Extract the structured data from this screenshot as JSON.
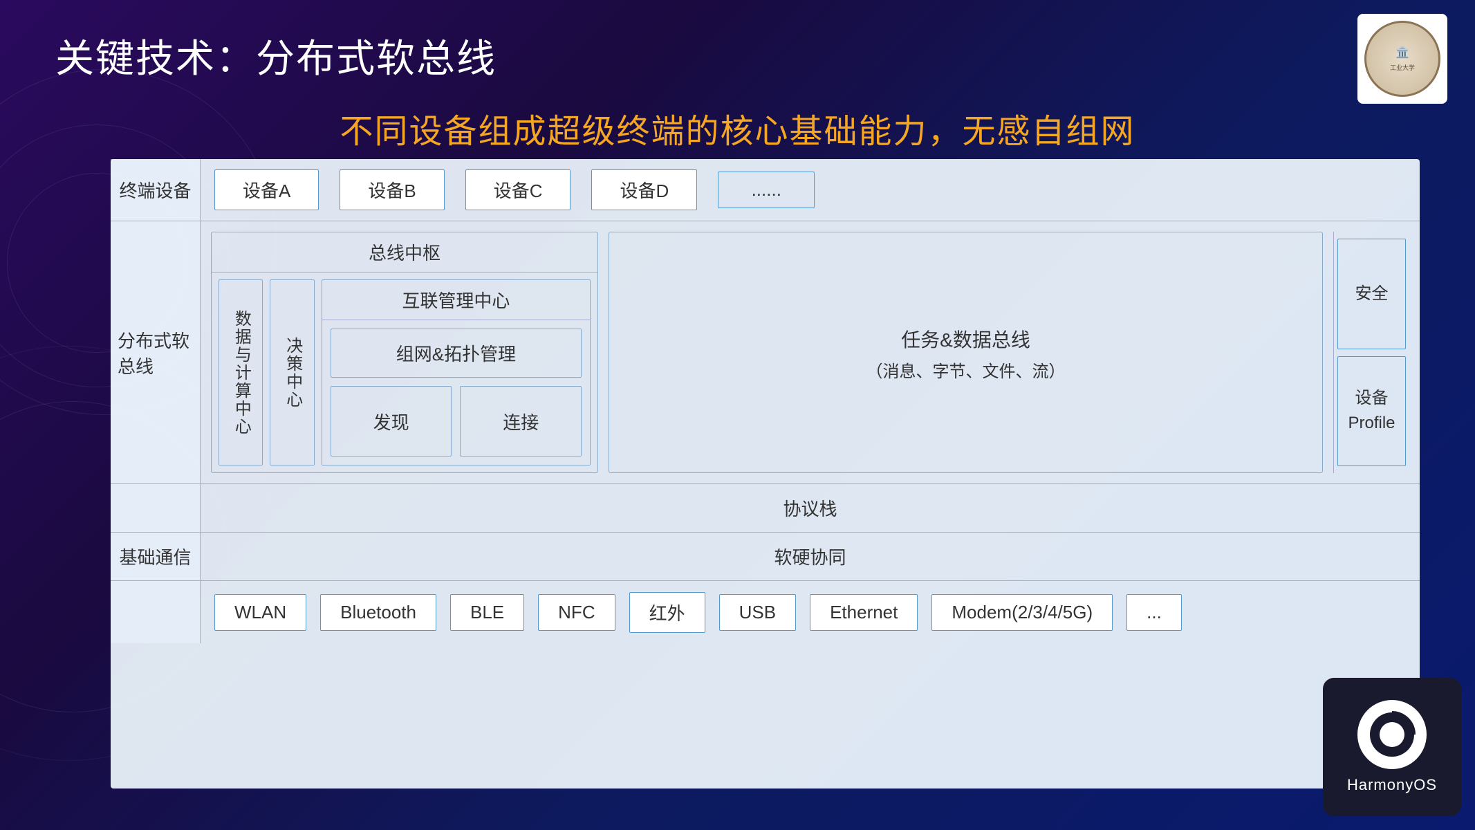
{
  "page": {
    "title": "关键技术：分布式软总线",
    "subtitle": "不同设备组成超级终端的核心基础能力，无感自组网"
  },
  "diagram": {
    "row_terminal": {
      "label": "终端设备",
      "devices": [
        "设备A",
        "设备B",
        "设备C",
        "设备D"
      ],
      "dots": "......"
    },
    "row_bus": {
      "label": "分布式软总线",
      "bus_hub": {
        "title": "总线中枢",
        "data_center": "数据与计算中心",
        "decision_center": "决策中心",
        "interconnect": {
          "title": "互联管理中心",
          "network_mgmt": "组网&拓扑管理",
          "discover": "发现",
          "connect": "连接"
        }
      },
      "task_bus": {
        "title": "任务&数据总线",
        "subtitle": "（消息、字节、文件、流）"
      },
      "right_items": {
        "safety": "安全",
        "device_profile": "设备\nProfile"
      }
    },
    "row_protocol": {
      "label": "",
      "content": "协议栈"
    },
    "row_basic": {
      "label": "基础通信",
      "soft_hard": "软硬协同",
      "technologies": [
        "WLAN",
        "Bluetooth",
        "BLE",
        "NFC",
        "红外",
        "USB",
        "Ethernet",
        "Modem(2/3/4/5G)",
        "..."
      ]
    }
  },
  "logos": {
    "top_right": "校徽",
    "bottom_right": "HarmonyOS"
  }
}
